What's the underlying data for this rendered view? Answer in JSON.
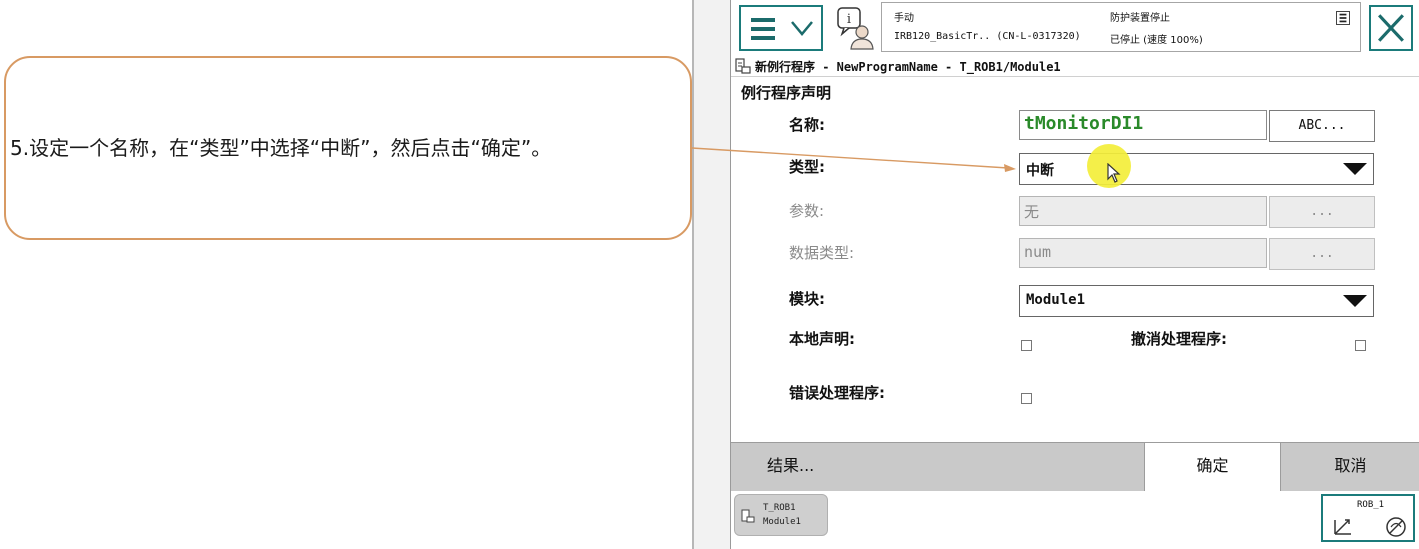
{
  "slide": {
    "instruction": "5.设定一个名称，在“类型”中选择“中断”，然后点击“确定”。"
  },
  "header": {
    "status_mode": "手动",
    "status_robot": "IRB120_BasicTr.. (CN-L-0317320)",
    "status_guard": "防护装置停止",
    "status_state": "已停止 (速度 100%)"
  },
  "window": {
    "title": "新例行程序 - NewProgramName - T_ROB1/Module1"
  },
  "form": {
    "section_title": "例行程序声明",
    "name_label": "名称:",
    "name_value": "tMonitorDI1",
    "name_button": "ABC...",
    "type_label": "类型:",
    "type_value": "中断",
    "params_label": "参数:",
    "params_value": "无",
    "params_button": "...",
    "datatype_label": "数据类型:",
    "datatype_value": "num",
    "datatype_button": "...",
    "module_label": "模块:",
    "module_value": "Module1",
    "local_label": "本地声明:",
    "undo_label": "撤消处理程序:",
    "error_label": "错误处理程序:"
  },
  "actions": {
    "result": "结果...",
    "ok": "确定",
    "cancel": "取消"
  },
  "taskbar": {
    "task_line1": "T_ROB1",
    "task_line2": "Module1",
    "quickset_label": "ROB_1"
  },
  "colors": {
    "accent": "#1b7b7b",
    "callout_border": "#d89a63",
    "highlight": "#f3ee3a",
    "name_text": "#2a8a2a"
  }
}
